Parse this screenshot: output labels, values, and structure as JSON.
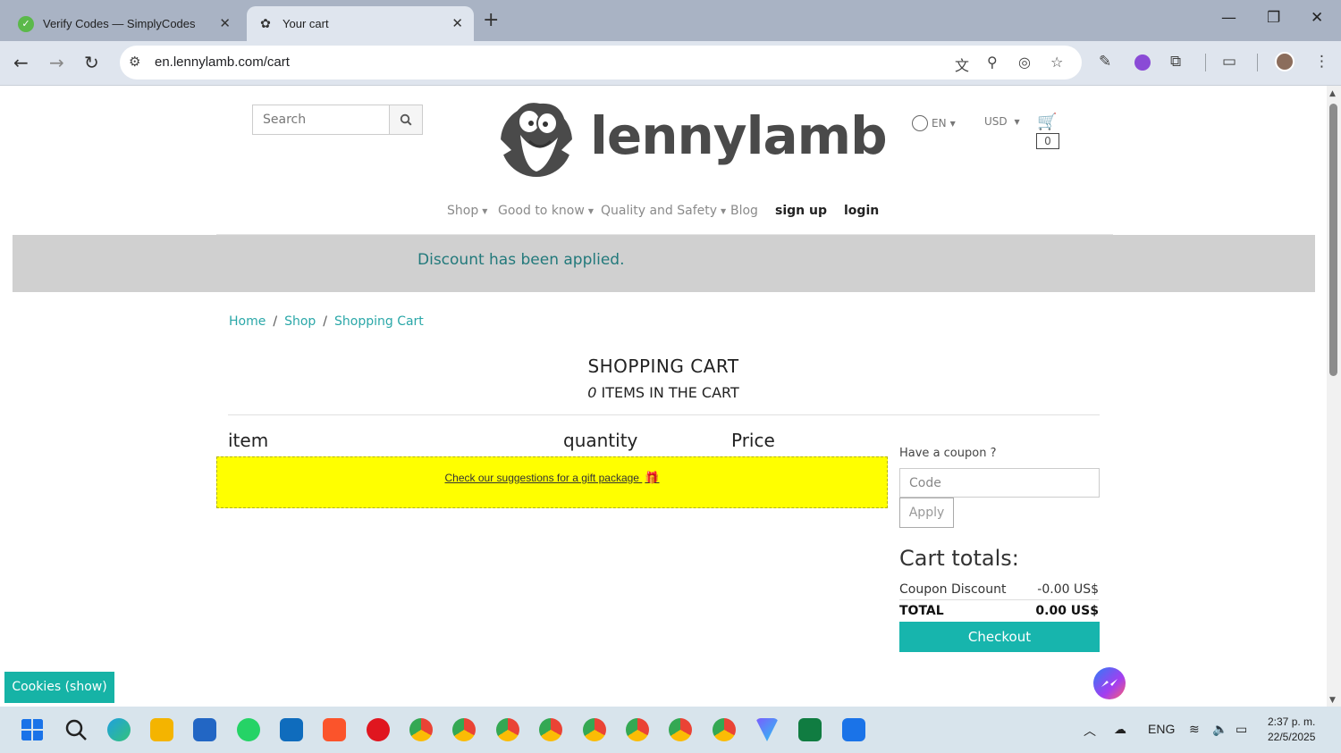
{
  "browser": {
    "tabs": [
      {
        "title": "Verify Codes — SimplyCodes"
      },
      {
        "title": "Your cart"
      }
    ],
    "url": "en.lennylamb.com/cart"
  },
  "header": {
    "search_placeholder": "Search",
    "logo_text": "lennylamb",
    "language": "EN",
    "currency": "USD",
    "cart_count": "0"
  },
  "nav": {
    "items": [
      "Shop",
      "Good to know",
      "Quality and Safety",
      "Blog"
    ],
    "sign_up": "sign up",
    "login": "login"
  },
  "notice": "Discount has been applied.",
  "breadcrumb": [
    "Home",
    "Shop",
    "Shopping Cart"
  ],
  "cart": {
    "title": "SHOPPING CART",
    "items_count": "0",
    "items_label": "ITEMS IN THE CART",
    "columns": [
      "item",
      "quantity",
      "Price"
    ],
    "gift_link": "Check our suggestions for a gift package"
  },
  "coupon": {
    "label": "Have a coupon ?",
    "placeholder": "Code",
    "apply": "Apply"
  },
  "totals": {
    "title": "Cart totals:",
    "discount_label": "Coupon Discount",
    "discount_value": "-0.00 US$",
    "total_label": "TOTAL",
    "total_value": "0.00 US$",
    "checkout": "Checkout"
  },
  "cookies_button": "Cookies (show)",
  "taskbar": {
    "language": "ENG",
    "time": "2:37 p. m.",
    "date": "22/5/2025"
  },
  "colors": {
    "accent_teal": "#17b5ad",
    "notice_bg": "#d0d0d0",
    "gift_bg": "#ffff00"
  }
}
